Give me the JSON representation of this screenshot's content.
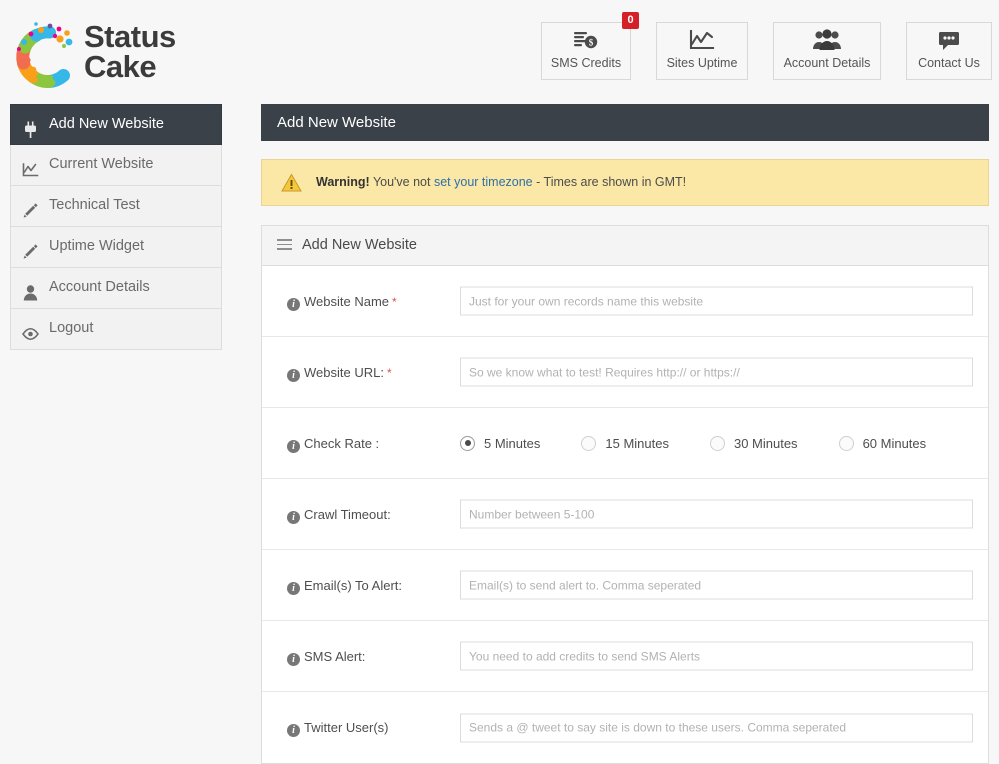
{
  "brand": {
    "name_line1": "Status",
    "name_line2": "Cake",
    "logo_icon": "statuscake-dots-logo"
  },
  "topnav": {
    "items": [
      {
        "label": "SMS Credits",
        "icon": "coins-dollar-icon",
        "badge": "0"
      },
      {
        "label": "Sites Uptime",
        "icon": "line-chart-icon"
      },
      {
        "label": "Account Details",
        "icon": "users-group-icon"
      },
      {
        "label": "Contact Us",
        "icon": "speech-bubble-icon"
      }
    ]
  },
  "sidebar": {
    "items": [
      {
        "label": "Add New Website",
        "icon": "plug-icon",
        "active": true
      },
      {
        "label": "Current Website",
        "icon": "line-chart-icon",
        "active": false
      },
      {
        "label": "Technical Test",
        "icon": "pencil-icon",
        "active": false
      },
      {
        "label": "Uptime Widget",
        "icon": "pencil-icon",
        "active": false
      },
      {
        "label": "Account Details",
        "icon": "user-icon",
        "active": false
      },
      {
        "label": "Logout",
        "icon": "eye-icon",
        "active": false
      }
    ]
  },
  "page": {
    "header_title": "Add New Website"
  },
  "warning": {
    "icon": "warning-triangle-icon",
    "strong": "Warning!",
    "text_before": "You've not ",
    "link": "set your timezone",
    "text_after": " - Times are shown in GMT!"
  },
  "panel": {
    "icon": "hamburger-list-icon",
    "title": "Add New Website",
    "fields": [
      {
        "label": "Website Name",
        "required": true,
        "type": "text",
        "placeholder": "Just for your own records name this website",
        "value": ""
      },
      {
        "label": "Website URL:",
        "required": true,
        "type": "text",
        "placeholder": "So we know what to test! Requires http:// or https://",
        "value": ""
      },
      {
        "label": "Check Rate :",
        "required": false,
        "type": "radio",
        "options": [
          {
            "label": "5 Minutes",
            "selected": true
          },
          {
            "label": "15 Minutes",
            "selected": false
          },
          {
            "label": "30 Minutes",
            "selected": false
          },
          {
            "label": "60 Minutes",
            "selected": false
          }
        ]
      },
      {
        "label": "Crawl Timeout:",
        "required": false,
        "type": "text",
        "placeholder": "Number between 5-100",
        "value": ""
      },
      {
        "label": "Email(s) To Alert:",
        "required": false,
        "type": "text",
        "placeholder": "Email(s) to send alert to. Comma seperated",
        "value": ""
      },
      {
        "label": "SMS Alert:",
        "required": false,
        "type": "text",
        "placeholder": "You need to add credits to send SMS Alerts",
        "value": ""
      },
      {
        "label": "Twitter User(s)",
        "required": false,
        "type": "text",
        "placeholder": "Sends a @ tweet to say site is down to these users. Comma seperated",
        "value": ""
      }
    ]
  },
  "colors": {
    "dark_header": "#3a4149",
    "warning_bg": "#fbe8a6",
    "badge_red": "#d62027",
    "link_blue": "#2f6fa8",
    "required_red": "#d9534f"
  }
}
